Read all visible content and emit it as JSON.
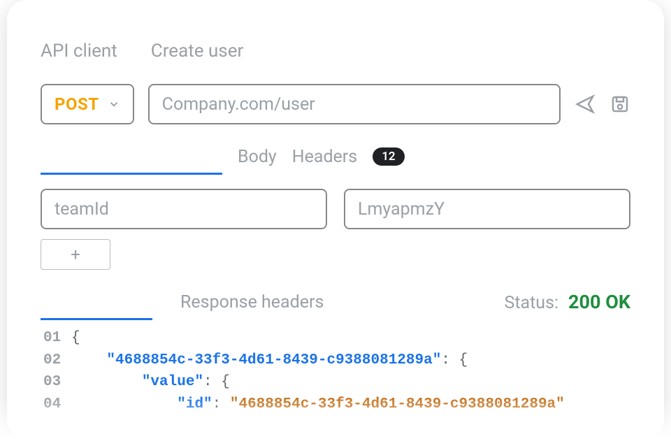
{
  "breadcrumbs": {
    "items": [
      "API client",
      "Create user"
    ]
  },
  "request": {
    "method": "POST",
    "url": "Company.com/user"
  },
  "tabs": {
    "body": "Body",
    "headers": "Headers",
    "headers_count": "12"
  },
  "params": {
    "key": "teamId",
    "value": "LmyapmzY",
    "add_label": "+"
  },
  "response": {
    "tab_headers_label": "Response headers",
    "status_label": "Status:",
    "status_value": "200 OK"
  },
  "code": {
    "lines": {
      "l1_brace": "{",
      "l2_key": "\"4688854c-33f3-4d61-8439-c9388081289a\"",
      "l2_colon": ":",
      "l2_brace": "{",
      "l3_key": "\"value\"",
      "l3_colon": ":",
      "l3_brace": "{",
      "l4_key": "\"id\"",
      "l4_colon": ":",
      "l4_val": "\"4688854c-33f3-4d61-8439-c9388081289a\""
    },
    "line_nums": {
      "n1": "01",
      "n2": "02",
      "n3": "03",
      "n4": "04"
    }
  }
}
